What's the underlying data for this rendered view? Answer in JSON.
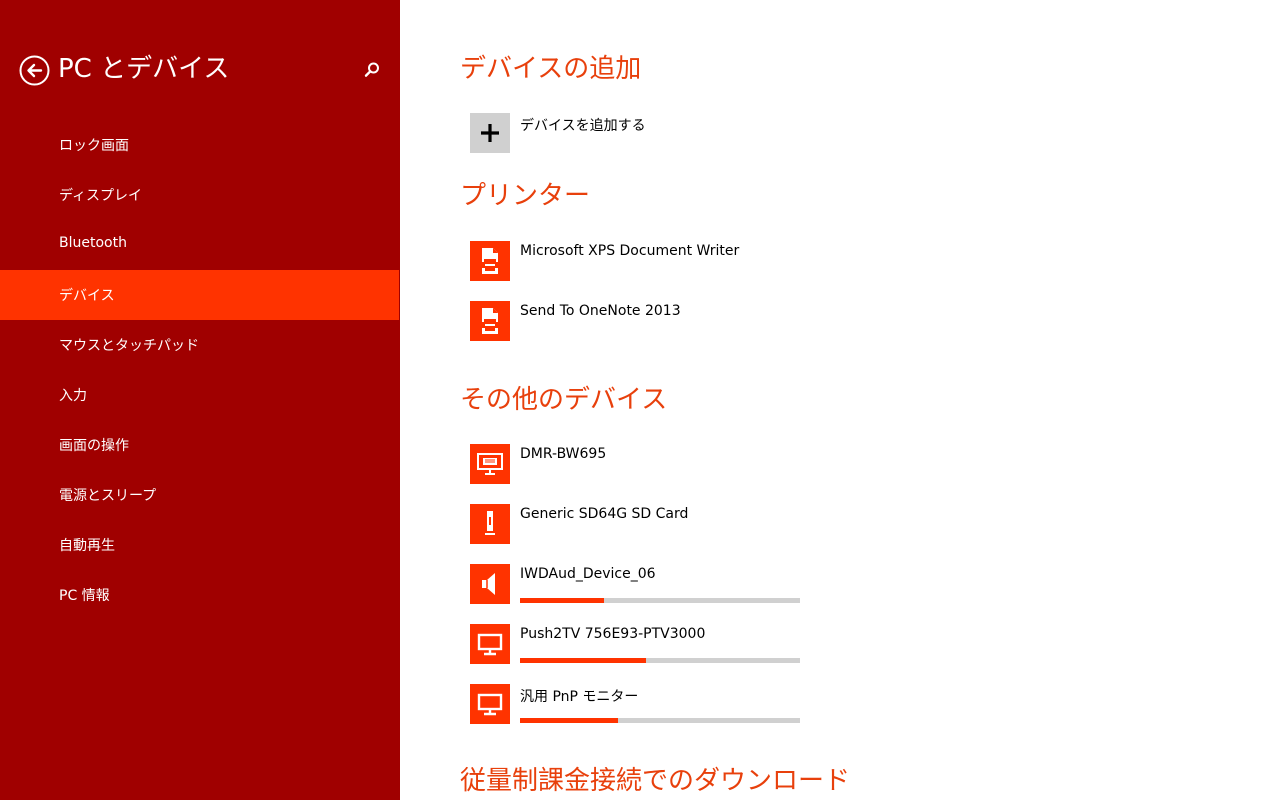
{
  "header": {
    "title": "PC とデバイス"
  },
  "sidebar": {
    "items": [
      {
        "label": "ロック画面"
      },
      {
        "label": "ディスプレイ"
      },
      {
        "label": "Bluetooth"
      },
      {
        "label": "デバイス",
        "active": true
      },
      {
        "label": "マウスとタッチパッド"
      },
      {
        "label": "入力"
      },
      {
        "label": "画面の操作"
      },
      {
        "label": "電源とスリープ"
      },
      {
        "label": "自動再生"
      },
      {
        "label": "PC 情報"
      }
    ]
  },
  "main": {
    "add_device": {
      "title": "デバイスの追加",
      "button_label": "デバイスを追加する"
    },
    "printers": {
      "title": "プリンター",
      "items": [
        {
          "name": "Microsoft XPS Document Writer",
          "icon": "printer-icon"
        },
        {
          "name": "Send To OneNote 2013",
          "icon": "printer-icon"
        }
      ]
    },
    "other_devices": {
      "title": "その他のデバイス",
      "items": [
        {
          "name": "DMR-BW695",
          "icon": "media-device-icon"
        },
        {
          "name": "Generic SD64G SD Card",
          "icon": "sd-card-icon"
        },
        {
          "name": "IWDAud_Device_06",
          "icon": "speaker-icon",
          "progress": 0.3
        },
        {
          "name": "Push2TV 756E93-PTV3000",
          "icon": "monitor-icon",
          "progress": 0.45
        },
        {
          "name": "汎用 PnP モニター",
          "icon": "monitor-icon",
          "progress": 0.35
        }
      ]
    },
    "metered": {
      "title": "従量制課金接続でのダウンロード"
    }
  },
  "colors": {
    "sidebar_bg": "#a00000",
    "accent": "#ff3300",
    "section_title": "#e8400c"
  }
}
